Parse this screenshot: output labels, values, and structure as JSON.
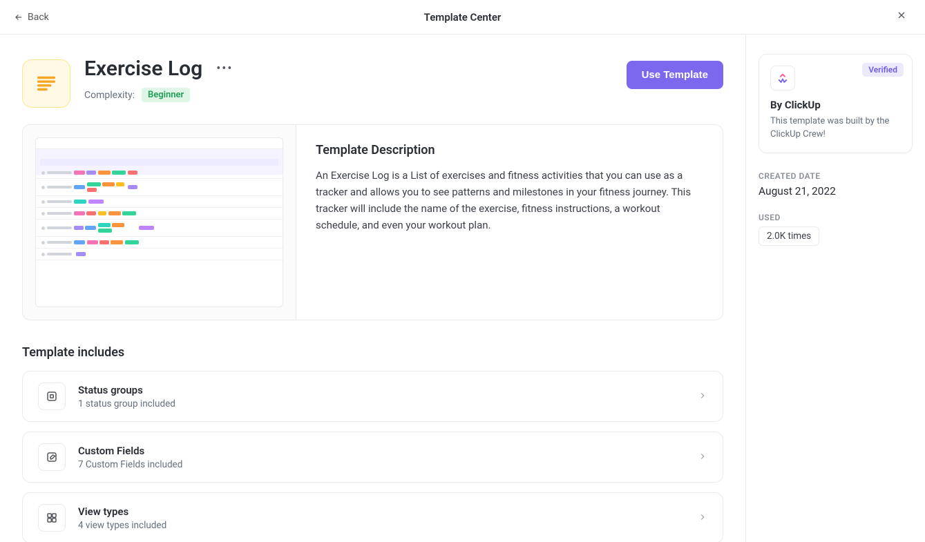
{
  "topbar": {
    "back": "Back",
    "title": "Template Center"
  },
  "template": {
    "name": "Exercise Log",
    "complexity_label": "Complexity:",
    "complexity_value": "Beginner",
    "use_button": "Use Template"
  },
  "description": {
    "heading": "Template Description",
    "body": "An Exercise Log is a List of exercises and fitness activities that you can use as a tracker and allows you to see patterns and milestones in your fitness journey. This tracker will include the name of the exercise, fitness instructions, a workout schedule, and even your workout plan."
  },
  "includes": {
    "heading": "Template includes",
    "items": [
      {
        "title": "Status groups",
        "subtitle": "1 status group included"
      },
      {
        "title": "Custom Fields",
        "subtitle": "7 Custom Fields included"
      },
      {
        "title": "View types",
        "subtitle": "4 view types included"
      }
    ]
  },
  "sidebar": {
    "verified": "Verified",
    "author_title": "By ClickUp",
    "author_desc": "This template was built by the ClickUp Crew!",
    "created_label": "CREATED DATE",
    "created_value": "August 21, 2022",
    "used_label": "USED",
    "used_value": "2.0K times"
  }
}
